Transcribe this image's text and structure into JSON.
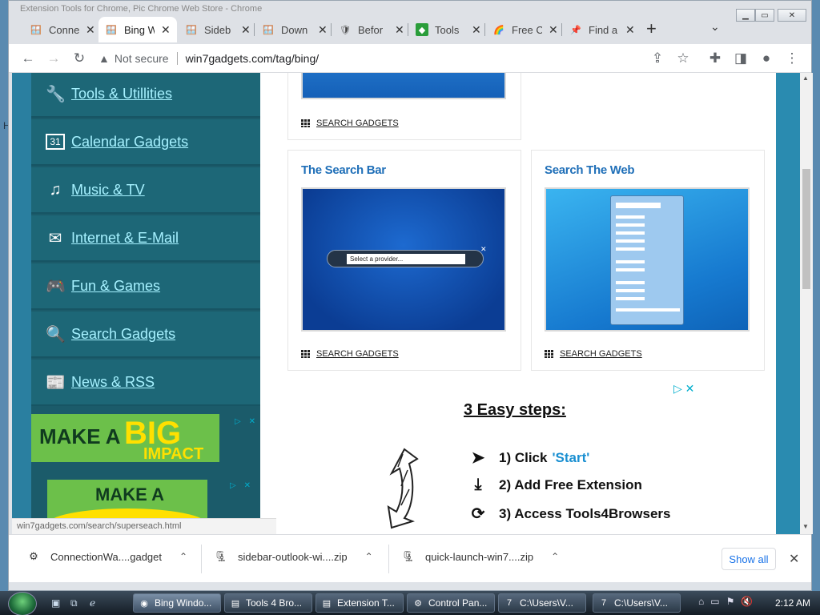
{
  "window": {
    "title": "Extension Tools for Chrome, Pic Chrome Web Store - Chrome"
  },
  "tabs": [
    {
      "label": "Conne",
      "icon": "windows-flag-icon"
    },
    {
      "label": "Bing W",
      "icon": "windows-flag-icon",
      "active": true
    },
    {
      "label": "Sideb",
      "icon": "windows-flag-icon"
    },
    {
      "label": "Down",
      "icon": "windows-flag-icon"
    },
    {
      "label": "Befor",
      "icon": "shield-icon"
    },
    {
      "label": "Tools",
      "icon": "green-square-icon"
    },
    {
      "label": "Free C",
      "icon": "rainbow-icon"
    },
    {
      "label": "Find a",
      "icon": "pin-icon"
    }
  ],
  "toolbar": {
    "security_label": "Not secure",
    "url": "win7gadgets.com/tag/bing/"
  },
  "sidebar": {
    "items": [
      {
        "label": "Tools & Utillities",
        "icon": "wrench-icon"
      },
      {
        "label": "Calendar Gadgets",
        "icon": "calendar-icon"
      },
      {
        "label": "Music & TV",
        "icon": "music-note-icon"
      },
      {
        "label": "Internet & E-Mail",
        "icon": "envelope-icon"
      },
      {
        "label": "Fun & Games",
        "icon": "gamepad-icon"
      },
      {
        "label": "Search Gadgets",
        "icon": "search-icon"
      },
      {
        "label": "News & RSS",
        "icon": "newspaper-icon"
      }
    ],
    "calendar_day": "31",
    "ad1": {
      "line1": "MAKE A",
      "line2": "BIG",
      "line3": "IMPACT"
    },
    "ad2": {
      "line1": "MAKE A"
    }
  },
  "cards": [
    {
      "category": "SEARCH GADGETS"
    },
    {
      "title": "The Search Bar",
      "category": "SEARCH GADGETS",
      "select_text": "Select a provider..."
    },
    {
      "title": "Search The Web",
      "category": "SEARCH GADGETS"
    }
  ],
  "promo": {
    "heading": "3 Easy steps:",
    "step1_prefix": "1) Click",
    "step1_highlight": "'Start'",
    "step2": "2) Add Free Extension",
    "step3": "3) Access Tools4Browsers"
  },
  "status_url": "win7gadgets.com/search/superseach.html",
  "downloads": [
    {
      "name": "ConnectionWa....gadget"
    },
    {
      "name": "sidebar-outlook-wi....zip"
    },
    {
      "name": "quick-launch-win7....zip"
    }
  ],
  "download_bar": {
    "show_all": "Show all"
  },
  "taskbar": {
    "buttons": [
      "Bing Windo...",
      "Tools 4 Bro...",
      "Extension T...",
      "Control Pan...",
      "C:\\Users\\V...",
      "C:\\Users\\V..."
    ],
    "clock": "2:12 AM"
  },
  "colors": {
    "accent": "#1f6fb8",
    "sidebar_link": "#a6f1ff",
    "sidebar_bg": "#1d6777"
  }
}
